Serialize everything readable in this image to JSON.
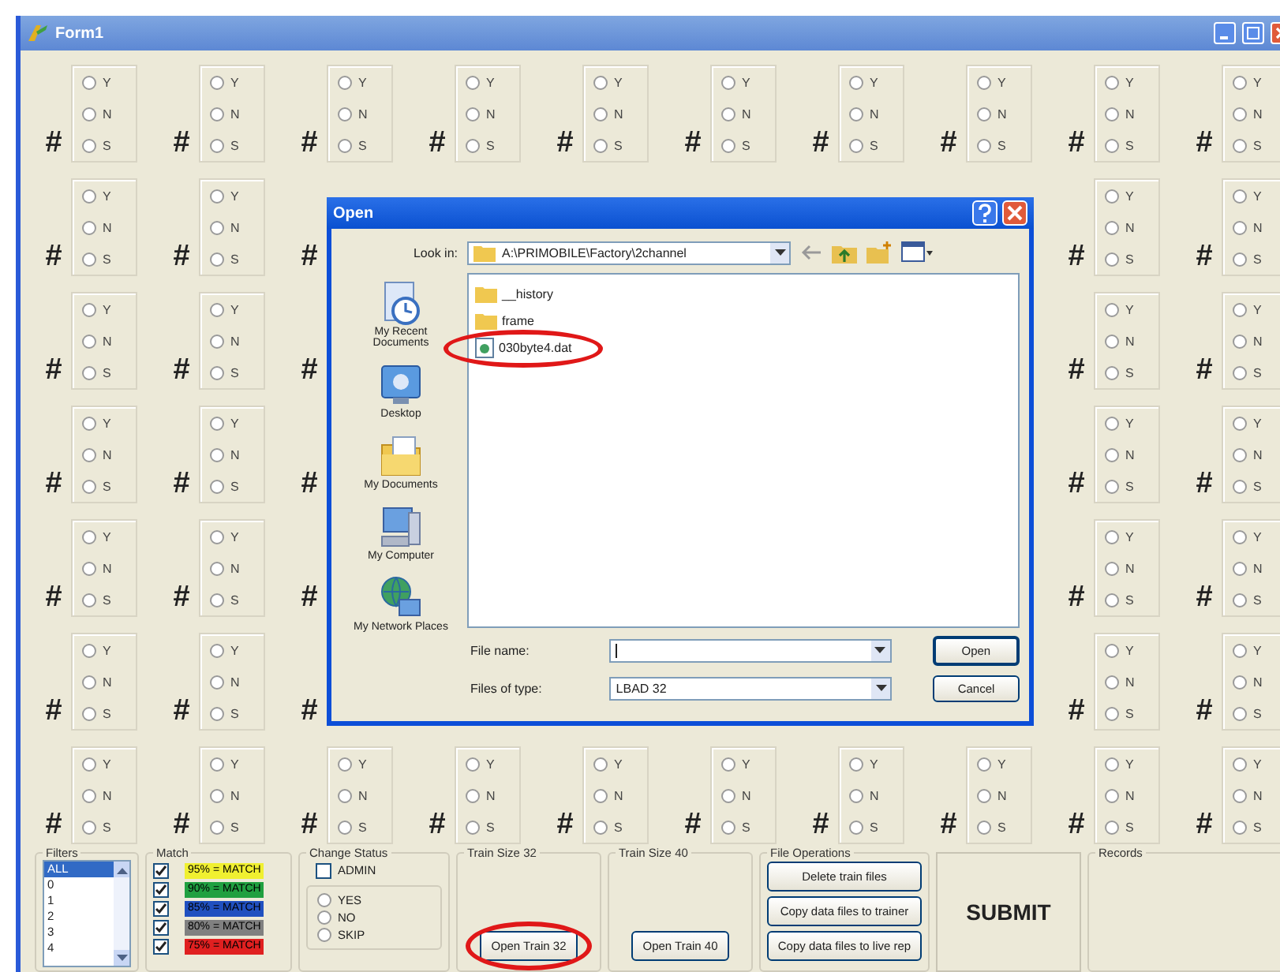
{
  "window": {
    "title": "Form1"
  },
  "grid": {
    "rows": [
      {
        "cells": [
          {
            "mark": "#",
            "options": [
              {
                "label": "Y",
                "selected": false
              },
              {
                "label": "N",
                "selected": false
              },
              {
                "label": "S",
                "selected": false
              }
            ]
          },
          {
            "mark": "#",
            "options": [
              {
                "label": "Y",
                "selected": false
              },
              {
                "label": "N",
                "selected": false
              },
              {
                "label": "S",
                "selected": false
              }
            ]
          },
          {
            "mark": "#",
            "options": [
              {
                "label": "Y",
                "selected": false
              },
              {
                "label": "N",
                "selected": false
              },
              {
                "label": "S",
                "selected": false
              }
            ]
          },
          {
            "mark": "#",
            "options": [
              {
                "label": "Y",
                "selected": false
              },
              {
                "label": "N",
                "selected": false
              },
              {
                "label": "S",
                "selected": false
              }
            ]
          },
          {
            "mark": "#",
            "options": [
              {
                "label": "Y",
                "selected": false
              },
              {
                "label": "N",
                "selected": false
              },
              {
                "label": "S",
                "selected": false
              }
            ]
          },
          {
            "mark": "#",
            "options": [
              {
                "label": "Y",
                "selected": false
              },
              {
                "label": "N",
                "selected": false
              },
              {
                "label": "S",
                "selected": false
              }
            ]
          },
          {
            "mark": "#",
            "options": [
              {
                "label": "Y",
                "selected": false
              },
              {
                "label": "N",
                "selected": false
              },
              {
                "label": "S",
                "selected": false
              }
            ]
          },
          {
            "mark": "#",
            "options": [
              {
                "label": "Y",
                "selected": false
              },
              {
                "label": "N",
                "selected": false
              },
              {
                "label": "S",
                "selected": false
              }
            ]
          },
          {
            "mark": "#",
            "options": [
              {
                "label": "Y",
                "selected": false
              },
              {
                "label": "N",
                "selected": false
              },
              {
                "label": "S",
                "selected": false
              }
            ]
          },
          {
            "mark": "#",
            "options": [
              {
                "label": "Y",
                "selected": false
              },
              {
                "label": "N",
                "selected": false
              },
              {
                "label": "S",
                "selected": false
              }
            ]
          }
        ]
      },
      {
        "cells": [
          {
            "mark": "#",
            "options": [
              {
                "label": "Y",
                "selected": false
              },
              {
                "label": "N",
                "selected": false
              },
              {
                "label": "S",
                "selected": false
              }
            ]
          },
          {
            "mark": "#",
            "options": [
              {
                "label": "Y",
                "selected": false
              },
              {
                "label": "N",
                "selected": false
              },
              {
                "label": "S",
                "selected": false
              }
            ]
          },
          {
            "mark": "#"
          },
          null,
          null,
          null,
          null,
          null,
          {
            "mark": "#",
            "options": [
              {
                "label": "Y",
                "selected": false
              },
              {
                "label": "N",
                "selected": false
              },
              {
                "label": "S",
                "selected": false
              }
            ]
          },
          {
            "mark": "#",
            "options": [
              {
                "label": "Y",
                "selected": false
              },
              {
                "label": "N",
                "selected": false
              },
              {
                "label": "S",
                "selected": false
              }
            ]
          }
        ]
      },
      {
        "cells": [
          {
            "mark": "#",
            "options": [
              {
                "label": "Y",
                "selected": false
              },
              {
                "label": "N",
                "selected": false
              },
              {
                "label": "S",
                "selected": false
              }
            ]
          },
          {
            "mark": "#",
            "options": [
              {
                "label": "Y",
                "selected": false
              },
              {
                "label": "N",
                "selected": false
              },
              {
                "label": "S",
                "selected": false
              }
            ]
          },
          {
            "mark": "#"
          },
          null,
          null,
          null,
          null,
          null,
          {
            "mark": "#",
            "options": [
              {
                "label": "Y",
                "selected": false
              },
              {
                "label": "N",
                "selected": false
              },
              {
                "label": "S",
                "selected": false
              }
            ]
          },
          {
            "mark": "#",
            "options": [
              {
                "label": "Y",
                "selected": false
              },
              {
                "label": "N",
                "selected": false
              },
              {
                "label": "S",
                "selected": false
              }
            ]
          }
        ]
      },
      {
        "cells": [
          {
            "mark": "#",
            "options": [
              {
                "label": "Y",
                "selected": false
              },
              {
                "label": "N",
                "selected": false
              },
              {
                "label": "S",
                "selected": false
              }
            ]
          },
          {
            "mark": "#",
            "options": [
              {
                "label": "Y",
                "selected": false
              },
              {
                "label": "N",
                "selected": false
              },
              {
                "label": "S",
                "selected": false
              }
            ]
          },
          {
            "mark": "#"
          },
          null,
          null,
          null,
          null,
          null,
          {
            "mark": "#",
            "options": [
              {
                "label": "Y",
                "selected": false
              },
              {
                "label": "N",
                "selected": false
              },
              {
                "label": "S",
                "selected": false
              }
            ]
          },
          {
            "mark": "#",
            "options": [
              {
                "label": "Y",
                "selected": false
              },
              {
                "label": "N",
                "selected": false
              },
              {
                "label": "S",
                "selected": false
              }
            ]
          }
        ]
      },
      {
        "cells": [
          {
            "mark": "#",
            "options": [
              {
                "label": "Y",
                "selected": false
              },
              {
                "label": "N",
                "selected": false
              },
              {
                "label": "S",
                "selected": false
              }
            ]
          },
          {
            "mark": "#",
            "options": [
              {
                "label": "Y",
                "selected": false
              },
              {
                "label": "N",
                "selected": false
              },
              {
                "label": "S",
                "selected": false
              }
            ]
          },
          {
            "mark": "#"
          },
          null,
          null,
          null,
          null,
          null,
          {
            "mark": "#",
            "options": [
              {
                "label": "Y",
                "selected": false
              },
              {
                "label": "N",
                "selected": false
              },
              {
                "label": "S",
                "selected": false
              }
            ]
          },
          {
            "mark": "#",
            "options": [
              {
                "label": "Y",
                "selected": false
              },
              {
                "label": "N",
                "selected": false
              },
              {
                "label": "S",
                "selected": false
              }
            ]
          }
        ]
      },
      {
        "cells": [
          {
            "mark": "#",
            "options": [
              {
                "label": "Y",
                "selected": false
              },
              {
                "label": "N",
                "selected": false
              },
              {
                "label": "S",
                "selected": false
              }
            ]
          },
          {
            "mark": "#",
            "options": [
              {
                "label": "Y",
                "selected": false
              },
              {
                "label": "N",
                "selected": false
              },
              {
                "label": "S",
                "selected": false
              }
            ]
          },
          {
            "mark": "#"
          },
          null,
          null,
          null,
          null,
          null,
          {
            "mark": "#",
            "options": [
              {
                "label": "Y",
                "selected": false
              },
              {
                "label": "N",
                "selected": false
              },
              {
                "label": "S",
                "selected": false
              }
            ]
          },
          {
            "mark": "#",
            "options": [
              {
                "label": "Y",
                "selected": false
              },
              {
                "label": "N",
                "selected": false
              },
              {
                "label": "S",
                "selected": false
              }
            ]
          }
        ]
      },
      {
        "cells": [
          {
            "mark": "#",
            "options": [
              {
                "label": "Y",
                "selected": false
              },
              {
                "label": "N",
                "selected": false
              },
              {
                "label": "S",
                "selected": false
              }
            ]
          },
          {
            "mark": "#",
            "options": [
              {
                "label": "Y",
                "selected": false
              },
              {
                "label": "N",
                "selected": false
              },
              {
                "label": "S",
                "selected": false
              }
            ]
          },
          {
            "mark": "#",
            "options": [
              {
                "label": "Y",
                "selected": false
              },
              {
                "label": "N",
                "selected": false
              },
              {
                "label": "S",
                "selected": false
              }
            ]
          },
          {
            "mark": "#",
            "options": [
              {
                "label": "Y",
                "selected": false
              },
              {
                "label": "N",
                "selected": false
              },
              {
                "label": "S",
                "selected": false
              }
            ]
          },
          {
            "mark": "#",
            "options": [
              {
                "label": "Y",
                "selected": false
              },
              {
                "label": "N",
                "selected": false
              },
              {
                "label": "S",
                "selected": false
              }
            ]
          },
          {
            "mark": "#",
            "options": [
              {
                "label": "Y",
                "selected": false
              },
              {
                "label": "N",
                "selected": false
              },
              {
                "label": "S",
                "selected": false
              }
            ]
          },
          {
            "mark": "#",
            "options": [
              {
                "label": "Y",
                "selected": false
              },
              {
                "label": "N",
                "selected": false
              },
              {
                "label": "S",
                "selected": false
              }
            ]
          },
          {
            "mark": "#",
            "options": [
              {
                "label": "Y",
                "selected": false
              },
              {
                "label": "N",
                "selected": false
              },
              {
                "label": "S",
                "selected": false
              }
            ]
          },
          {
            "mark": "#",
            "options": [
              {
                "label": "Y",
                "selected": false
              },
              {
                "label": "N",
                "selected": false
              },
              {
                "label": "S",
                "selected": false
              }
            ]
          },
          {
            "mark": "#",
            "options": [
              {
                "label": "Y",
                "selected": false
              },
              {
                "label": "N",
                "selected": false
              },
              {
                "label": "S",
                "selected": false
              }
            ]
          }
        ]
      }
    ]
  },
  "filters": {
    "title": "Filters",
    "items": [
      {
        "label": "ALL",
        "selected": true
      },
      {
        "label": "0",
        "selected": false
      },
      {
        "label": "1",
        "selected": false
      },
      {
        "label": "2",
        "selected": false
      },
      {
        "label": "3",
        "selected": false
      },
      {
        "label": "4",
        "selected": false
      }
    ]
  },
  "match": {
    "title": "Match",
    "items": [
      {
        "label": "95% = MATCH",
        "checked": true,
        "color": "#f0f030"
      },
      {
        "label": "90% = MATCH",
        "checked": true,
        "color": "#20a040"
      },
      {
        "label": "85% = MATCH",
        "checked": true,
        "color": "#2050c0"
      },
      {
        "label": "80% = MATCH",
        "checked": true,
        "color": "#808080"
      },
      {
        "label": "75% = MATCH",
        "checked": true,
        "color": "#e02020"
      }
    ]
  },
  "change_status": {
    "title": "Change Status",
    "admin": {
      "label": "ADMIN",
      "checked": false
    },
    "options": [
      {
        "label": "YES",
        "selected": false
      },
      {
        "label": "NO",
        "selected": false
      },
      {
        "label": "SKIP",
        "selected": false
      }
    ]
  },
  "train_32": {
    "title": "Train Size 32",
    "button": {
      "label": "Open Train 32",
      "highlighted": true
    }
  },
  "train_40": {
    "title": "Train Size 40",
    "button": {
      "label": "Open Train 40",
      "highlighted": false
    }
  },
  "file_operations": {
    "title": "File Operations",
    "buttons": [
      "Delete train files",
      "Copy data files to trainer",
      "Copy data files to live rep"
    ]
  },
  "submit": {
    "label": "SUBMIT"
  },
  "records": {
    "title": "Records"
  },
  "dialog": {
    "title": "Open",
    "look_in_label": "Look in:",
    "look_in": "A:\\PRIMOBILE\\Factory\\2channel",
    "places": [
      {
        "label": "My Recent Documents",
        "kind": "recent"
      },
      {
        "label": "Desktop",
        "kind": "desktop"
      },
      {
        "label": "My Documents",
        "kind": "documents"
      },
      {
        "label": "My Computer",
        "kind": "computer"
      },
      {
        "label": "My Network Places",
        "kind": "network"
      }
    ],
    "files": [
      {
        "name": "__history",
        "kind": "folder",
        "highlighted": false
      },
      {
        "name": "frame",
        "kind": "folder",
        "highlighted": false
      },
      {
        "name": "030byte4.dat",
        "kind": "file",
        "highlighted": true
      }
    ],
    "file_name_label": "File name:",
    "file_type_label": "Files of type:",
    "file_type": "LBAD 32",
    "buttons": [
      "Open",
      "Cancel"
    ]
  }
}
